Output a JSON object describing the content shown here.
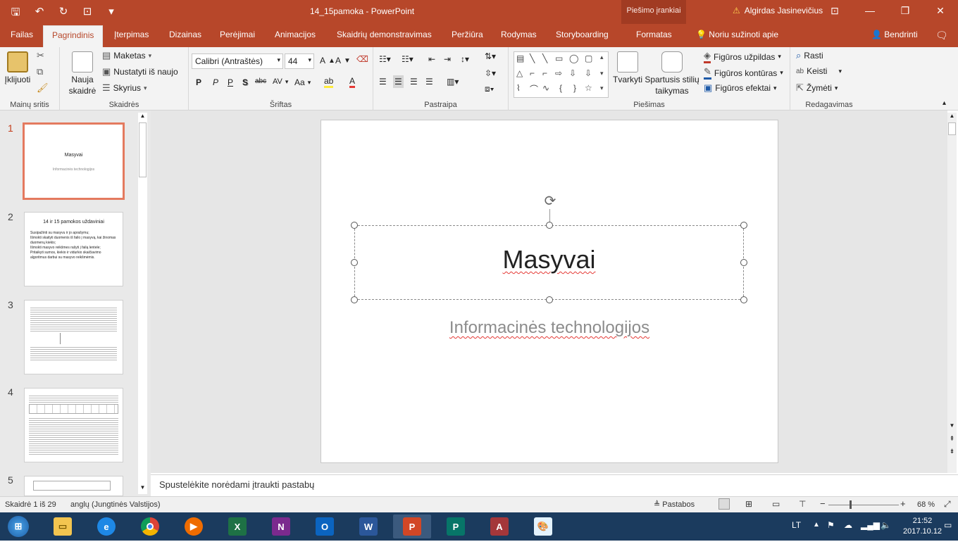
{
  "titlebar": {
    "document_title": "14_15pamoka  -  PowerPoint",
    "contextual_tab": "Piešimo įrankiai",
    "user_name": "Algirdas Jasinevičius"
  },
  "tabs": [
    "Failas",
    "Pagrindinis",
    "Įterpimas",
    "Dizainas",
    "Perėjimai",
    "Animacijos",
    "Skaidrių demonstravimas",
    "Peržiūra",
    "Rodymas",
    "Storyboarding",
    "Formatas"
  ],
  "tell_me": "Noriu sužinoti apie",
  "share": "Bendrinti",
  "ribbon": {
    "clipboard": {
      "paste": "Įklijuoti",
      "label": "Mainų sritis"
    },
    "slides": {
      "new_slide_1": "Nauja",
      "new_slide_2": "skaidrė",
      "layout": "Maketas",
      "reset": "Nustatyti iš naujo",
      "section": "Skyrius",
      "label": "Skaidrės"
    },
    "font": {
      "font_name": "Calibri (Antraštės)",
      "font_size": "44",
      "bold": "P",
      "italic": "P",
      "underline": "P",
      "shadow": "S",
      "strike": "abc",
      "spacing": "AV",
      "case": "Aa",
      "label": "Šriftas"
    },
    "paragraph": {
      "label": "Pastraipa"
    },
    "drawing": {
      "arrange": "Tvarkyti",
      "quick_styles_1": "Spartusis stilių",
      "quick_styles_2": "taikymas",
      "fill": "Figūros užpildas",
      "outline": "Figūros kontūras",
      "effects": "Figūros efektai",
      "label": "Piešimas"
    },
    "editing": {
      "find": "Rasti",
      "replace": "Keisti",
      "select": "Žymėti",
      "label": "Redagavimas"
    }
  },
  "thumbnails": {
    "numbers": [
      "1",
      "2",
      "3",
      "4",
      "5"
    ],
    "t1_title": "Masyvai",
    "t1_sub": "Informacinės technologijos",
    "t2_title": "14 ir 15 pamokos uždaviniai",
    "t2_bullets": [
      "Susipažinti su masyvu ir jo aprašymu;",
      "Išmokti skaityti duomenis iš failo į masyvą, kai žinomas duomenų kiekis;",
      "Išmokti masyvo reikšmes rašyti į failą lentele;",
      "Pritaikyti sumos, kiekio ir vidurkio skaičiavimo algoritmus darbui su masyvo reikšmėmis."
    ]
  },
  "slide": {
    "title": "Masyvai",
    "subtitle": "Informacinės technologijos"
  },
  "notes_placeholder": "Spustelėkite norėdami įtraukti pastabų",
  "status": {
    "slide_count": "Skaidrė 1 iš 29",
    "language": "anglų (Jungtinės Valstijos)",
    "notes": "Pastabos",
    "zoom": "68 %"
  },
  "tray": {
    "lang": "LT",
    "time": "21:52",
    "date": "2017.10.12"
  },
  "taskbar_apps": [
    "start",
    "file-explorer",
    "internet-explorer",
    "chrome",
    "media-player",
    "excel",
    "onenote",
    "outlook",
    "word",
    "powerpoint",
    "publisher",
    "access",
    "paint"
  ]
}
